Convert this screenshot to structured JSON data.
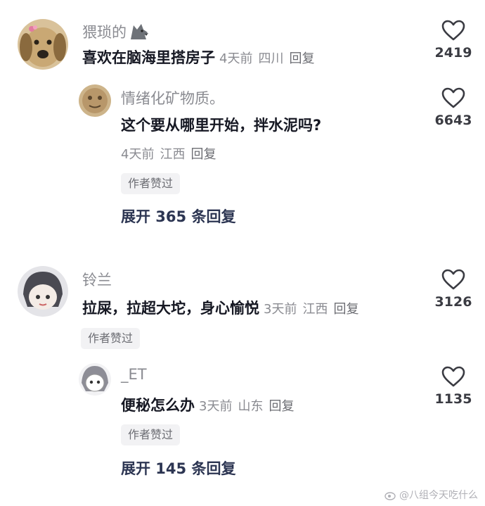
{
  "comments": [
    {
      "username": "猥琐的",
      "text": "喜欢在脑海里搭房子",
      "time": "4天前",
      "location": "四川",
      "reply_label": "回复",
      "likes": "2419",
      "replies": [
        {
          "username": "情绪化矿物质。",
          "text": "这个要从哪里开始，拌水泥吗?",
          "time": "4天前",
          "location": "江西",
          "reply_label": "回复",
          "likes": "6643",
          "badge": "作者赞过"
        }
      ],
      "expand_label": "展开 365 条回复"
    },
    {
      "username": "铃兰",
      "text": "拉屎，拉超大坨，身心愉悦",
      "time": "3天前",
      "location": "江西",
      "reply_label": "回复",
      "likes": "3126",
      "badge": "作者赞过",
      "replies": [
        {
          "username": "_ET",
          "text": "便秘怎么办",
          "time": "3天前",
          "location": "山东",
          "reply_label": "回复",
          "likes": "1135",
          "badge": "作者赞过"
        }
      ],
      "expand_label": "展开 145 条回复"
    }
  ],
  "watermark": "@八组今天吃什么",
  "icons": {
    "like": "heart-outline-icon",
    "emoji": "wolf-emoji-icon",
    "weibo": "weibo-logo-icon"
  },
  "colors": {
    "username": "#8a8b91",
    "text": "#161823",
    "expand": "#2c3552",
    "badge_bg": "#f2f2f4"
  }
}
